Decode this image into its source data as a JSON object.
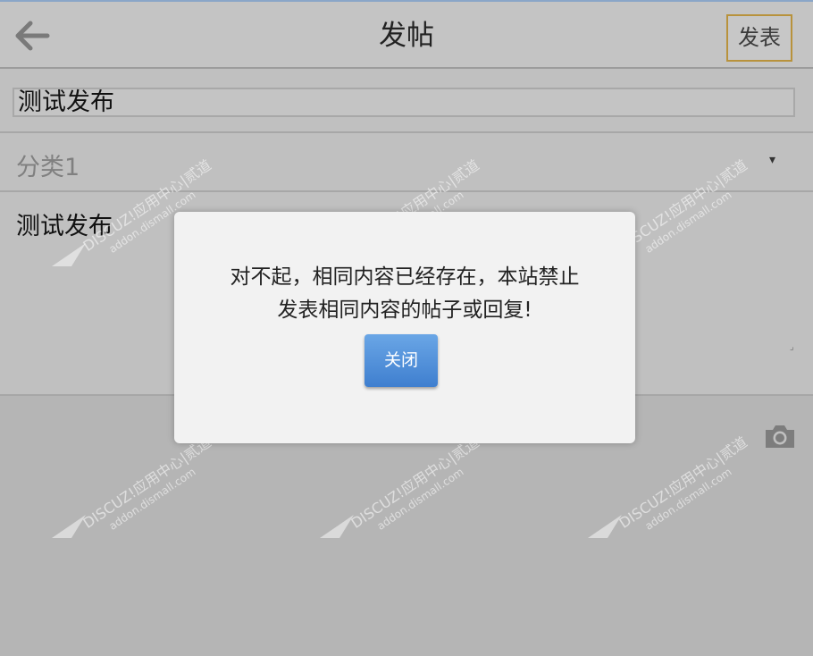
{
  "header": {
    "title": "发帖",
    "publish_label": "发表",
    "back_icon": "arrow-left-icon"
  },
  "form": {
    "subject_value": "测试发布",
    "category_value": "分类1",
    "category_arrow": "▾",
    "content_value": "测试发布",
    "upload_icon": "camera-icon",
    "resize_mark": "⌟"
  },
  "dialog": {
    "message_line1": "对不起，相同内容已经存在，本站禁止",
    "message_line2": "发表相同内容的帖子或回复!",
    "close_label": "关闭"
  },
  "watermark": {
    "line1": "DISCUZ!应用中心|贰道",
    "line2": "addon.dismall.com"
  },
  "colors": {
    "accent_border": "#b8923c",
    "button_blue": "#4a8ad8"
  }
}
